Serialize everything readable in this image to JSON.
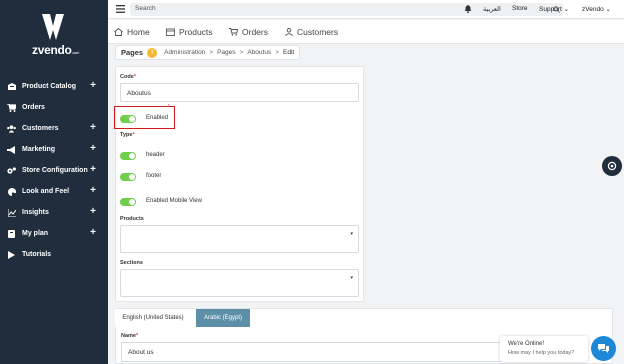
{
  "brand": {
    "logo_text": "zvendo",
    "logo_suffix": ".com"
  },
  "sidebar": {
    "items": [
      {
        "label": "Product Catalog",
        "icon": "box-icon",
        "expandable": true
      },
      {
        "label": "Orders",
        "icon": "cart-icon",
        "expandable": false
      },
      {
        "label": "Customers",
        "icon": "users-icon",
        "expandable": true
      },
      {
        "label": "Marketing",
        "icon": "megaphone-icon",
        "expandable": true
      },
      {
        "label": "Store Configuration",
        "icon": "cogs-icon",
        "expandable": true
      },
      {
        "label": "Look and Feel",
        "icon": "palette-icon",
        "expandable": true
      },
      {
        "label": "Insights",
        "icon": "chart-icon",
        "expandable": true
      },
      {
        "label": "My plan",
        "icon": "book-icon",
        "expandable": true
      },
      {
        "label": "Tutorials",
        "icon": "play-icon",
        "expandable": false
      }
    ],
    "plus_glyph": "+"
  },
  "topbar": {
    "search_placeholder": "Search",
    "language": "العربية",
    "store": "Store",
    "support": "Support",
    "user": "zVendo",
    "chevron": "⌄"
  },
  "subnav": {
    "home": "Home",
    "products": "Products",
    "orders": "Orders",
    "customers": "Customers"
  },
  "breadcrumb": {
    "section": "Pages",
    "badge": "!",
    "items": [
      "Administration",
      "Pages",
      "Aboutus",
      "Edit"
    ],
    "separator": ">"
  },
  "form": {
    "code_label": "Code",
    "code_value": "Aboutus",
    "required_mark": "*",
    "enabled_label": "Enabled",
    "type_label": "Type",
    "type_header": "header",
    "type_footer": "footer",
    "mobile_label": "Enabled Mobile View",
    "products_label": "Products",
    "sections_label": "Sections",
    "caret": "▾"
  },
  "tabs": {
    "english": "English (United States)",
    "arabic": "Arabic (Egypt)"
  },
  "localized": {
    "name_label": "Name",
    "name_value": "About us"
  },
  "chat": {
    "line1": "We're Online!",
    "line2": "How may I help you today?"
  },
  "colors": {
    "sidebar": "#1f2d3d",
    "toggle_on": "#6fcf4c",
    "highlight": "#d01c1c",
    "tab_inactive": "#5e8fa8",
    "chat": "#1e88d8"
  }
}
